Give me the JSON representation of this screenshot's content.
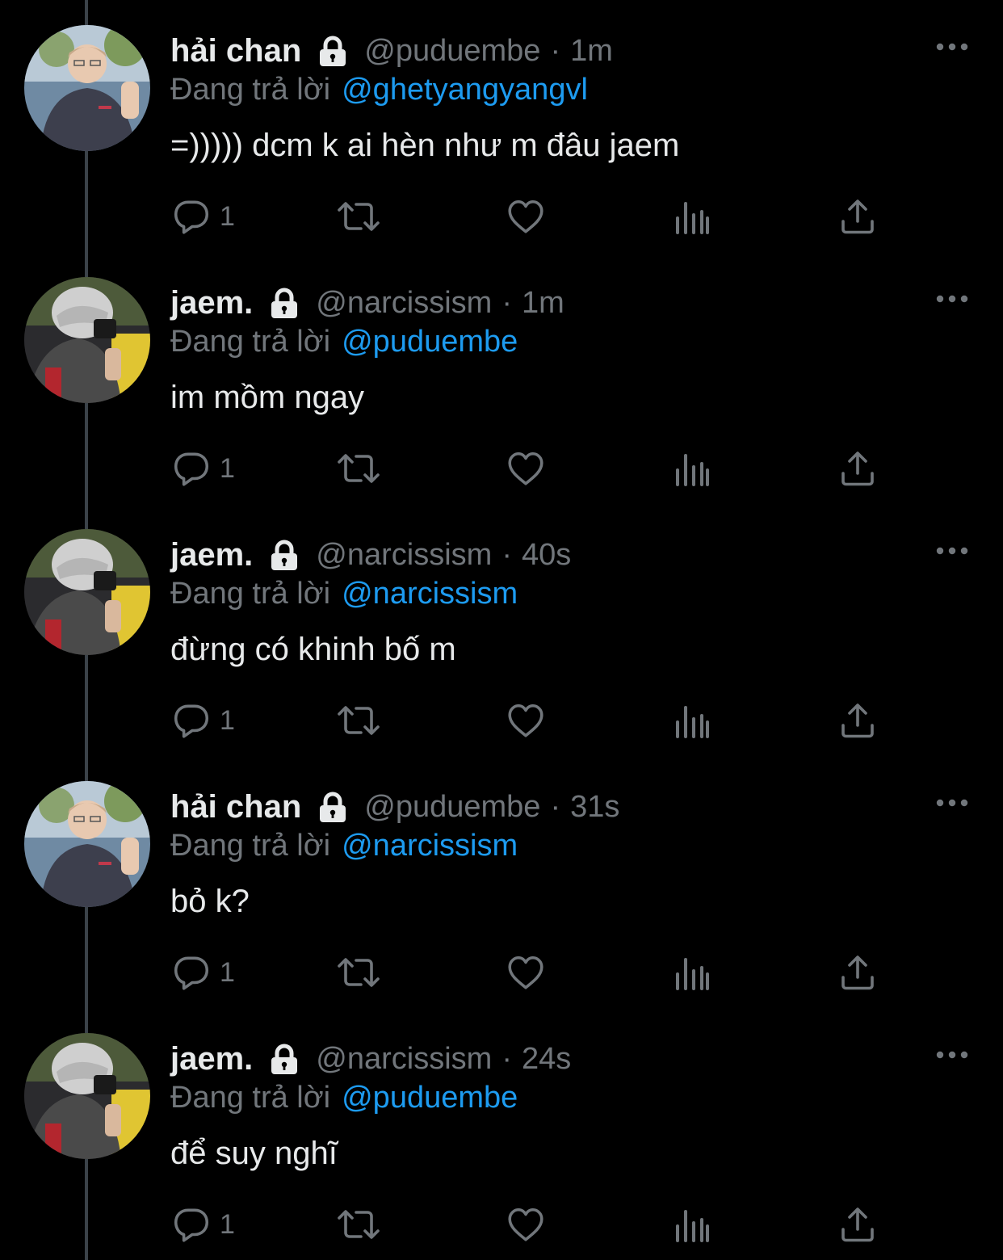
{
  "tweets": [
    {
      "display_name": "hải chan",
      "handle": "@puduembe",
      "separator": "·",
      "time": "1m",
      "reply_prefix": "Đang trả lời",
      "reply_to": "@ghetyangyangvl",
      "text": "=))))) dcm k ai hèn như m đâu jaem",
      "reply_count": "1",
      "avatar": "puduembe"
    },
    {
      "display_name": "jaem.",
      "handle": "@narcissism",
      "separator": "·",
      "time": "1m",
      "reply_prefix": "Đang trả lời",
      "reply_to": "@puduembe",
      "text": "im mồm ngay",
      "reply_count": "1",
      "avatar": "narcissism"
    },
    {
      "display_name": "jaem.",
      "handle": "@narcissism",
      "separator": "·",
      "time": "40s",
      "reply_prefix": "Đang trả lời",
      "reply_to": "@narcissism",
      "text": "đừng có khinh bố m",
      "reply_count": "1",
      "avatar": "narcissism"
    },
    {
      "display_name": "hải chan",
      "handle": "@puduembe",
      "separator": "·",
      "time": "31s",
      "reply_prefix": "Đang trả lời",
      "reply_to": "@narcissism",
      "text": "bỏ k?",
      "reply_count": "1",
      "avatar": "puduembe"
    },
    {
      "display_name": "jaem.",
      "handle": "@narcissism",
      "separator": "·",
      "time": "24s",
      "reply_prefix": "Đang trả lời",
      "reply_to": "@puduembe",
      "text": "để suy nghĩ",
      "reply_count": "1",
      "avatar": "narcissism"
    }
  ],
  "icons": {
    "protected": "lock-icon",
    "more": "more-icon",
    "reply": "reply-icon",
    "retweet": "retweet-icon",
    "like": "heart-icon",
    "views": "analytics-icon",
    "share": "share-icon"
  },
  "colors": {
    "background": "#000000",
    "text": "#e7e9ea",
    "muted": "#71767b",
    "link": "#1d9bf0",
    "thread_line": "#3b4249"
  }
}
